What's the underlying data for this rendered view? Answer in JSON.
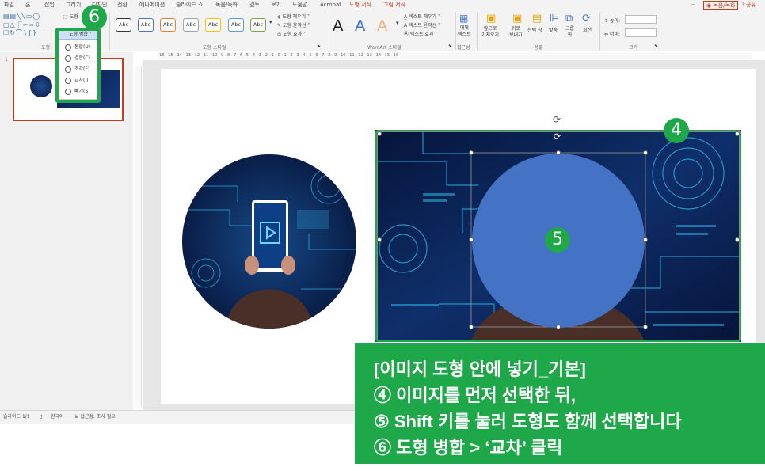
{
  "menu": {
    "tabs": [
      "파일",
      "홈",
      "삽입",
      "그리기",
      "디자인",
      "전환",
      "애니메이션",
      "슬라이드 쇼",
      "녹음/녹화",
      "검토",
      "보기",
      "도움말",
      "Acrobat",
      "도형 서식",
      "그림 서식"
    ],
    "active_tab": "도형 서식",
    "record_label": "◉ 녹음/녹화",
    "share_label": "공유"
  },
  "ribbon": {
    "shapes_group_label": "도형",
    "merge_button": "도형 병합",
    "merge_menu": [
      "통합(U)",
      "결합(C)",
      "조각(F)",
      "교차(I)",
      "빼기(S)"
    ],
    "abc_label": "Abc",
    "shape_fill": "도형 채우기",
    "shape_outline": "도형 윤곽선",
    "shape_effects": "도형 효과",
    "shape_styles_label": "도형 스타일",
    "wordart_letter": "A",
    "text_fill": "텍스트 채우기",
    "text_outline": "텍스트 윤곽선",
    "text_effects": "텍스트 효과",
    "wordart_label": "WordArt 스타일",
    "alt_text": "대체\n텍스트",
    "accessibility_label": "접근성",
    "bring_forward": "앞으로\n가져오기",
    "send_backward": "뒤로\n보내기",
    "selection_pane": "선택 창",
    "align": "맞춤",
    "group": "그룹\n화",
    "rotate": "회전",
    "arrange_label": "정렬",
    "height_label": "높이:",
    "width_label": "너비:",
    "size_label": "크기"
  },
  "slides_pane": {
    "slide_number": "1"
  },
  "ruler_top": "· 16 · 15 · 14 · 13 · 12 · 11 · 10 · 9 · 8 · 7 · 6 · 5 · 4 · 3 · 2 · 1 · 0 · 1 · 2 · 3 · 4 · 5 · 6 · 7 · 8 · 9 · 10 · 11 · 12 · 13 · 14 · 15 · 16 ·",
  "status": {
    "slide_info": "슬라이드 1/1",
    "language": "한국어",
    "accessibility": "접근성: 조사 필요"
  },
  "badges": {
    "b4": "4",
    "b5": "5",
    "b6": "6"
  },
  "callout": {
    "line1": "[이미지 도형 안에 넣기_기본]",
    "line2": "④  이미지를 먼저 선택한 뒤,",
    "line3": "⑤  Shift 키를 눌러 도형도 함께 선택합니다",
    "line4": "⑥  도형 병합 > ‘교차’ 클릭"
  },
  "colors": {
    "accent_green": "#1fa84a",
    "shape_blue": "#4472c4",
    "context_tab": "#c43e1c",
    "tech_bg": "#0a1a4a"
  }
}
